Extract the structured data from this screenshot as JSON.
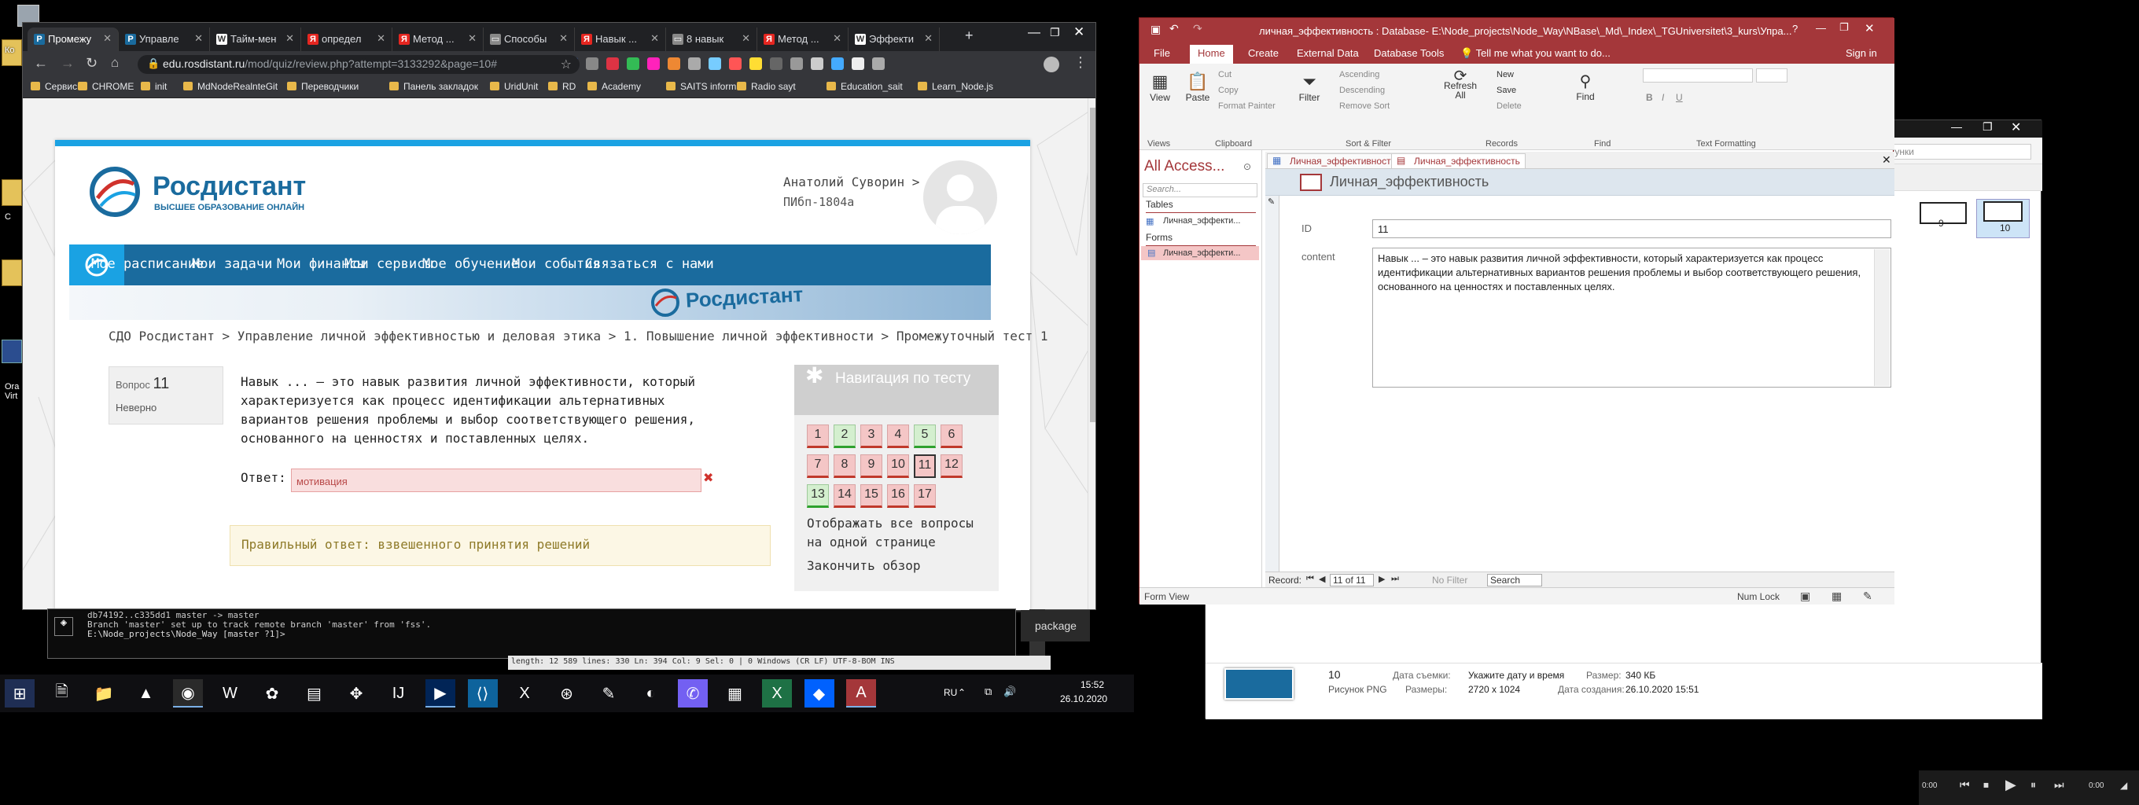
{
  "desktop": {
    "icons": [
      {
        "label": "Ко"
      },
      {
        "label": "С"
      },
      {
        "label": "Ora Virt"
      }
    ]
  },
  "chrome": {
    "tabs": [
      {
        "label": "Промежу",
        "fav": "Р",
        "color": "#1a6b9e",
        "active": true
      },
      {
        "label": "Управле",
        "fav": "Р",
        "color": "#1a6b9e"
      },
      {
        "label": "Тайм-мен",
        "fav": "W",
        "color": "#fff"
      },
      {
        "label": "определ",
        "fav": "Я",
        "color": "#e52620"
      },
      {
        "label": "Метод ...",
        "fav": "Я",
        "color": "#e52620"
      },
      {
        "label": "Способы",
        "fav": "▭",
        "color": "#888"
      },
      {
        "label": "Навык ...",
        "fav": "Я",
        "color": "#e52620"
      },
      {
        "label": "8 навык",
        "fav": "▭",
        "color": "#888"
      },
      {
        "label": "Метод ...",
        "fav": "Я",
        "color": "#e52620"
      },
      {
        "label": "Эффекти",
        "fav": "W",
        "color": "#fff"
      }
    ],
    "url_host": "edu.rosdistant.ru",
    "url_path": "/mod/quiz/review.php?attempt=3133292&page=10#",
    "bookmarks": [
      "Сервисы",
      "CHROME",
      "init",
      "MdNodeRealnteGit",
      "Переводчики",
      "Панель закладок",
      "UridUnit",
      "RD",
      "Academy",
      "SAITS inform",
      "Radio sayt",
      "Education_sait",
      "Learn_Node.js"
    ]
  },
  "site": {
    "brand": "Росдистант",
    "tagline": "ВЫСШЕЕ ОБРАЗОВАНИЕ ОНЛАЙН",
    "user_name": "Анатолий Суворин",
    "user_chev": ">",
    "user_group": "ПИбп-1804а",
    "nav": [
      "Мое расписание",
      "Мои задачи",
      "Мои финансы",
      "Мои сервисы",
      "Мое обучение",
      "Мои события",
      "Связаться с нами"
    ],
    "banner_brand": "Росдистант",
    "breadcrumb": "СДО Росдистант > Управление личной эффективностью и деловая этика > 1. Повышение личной эффективности > Промежуточный тест 1"
  },
  "quiz": {
    "qlabel": "Вопрос",
    "qnum": "11",
    "status": "Неверно",
    "text": "Навык ... – это навык развития личной эффективности, который характеризуется как процесс идентификации альтернативных вариантов решения проблемы и выбор соответствующего решения, основанного на ценностях и поставленных целях.",
    "answer_label": "Ответ:",
    "answer_value": "мотивация",
    "wrong_mark": "✖",
    "correct": "Правильный ответ: взвешенного принятия решений",
    "nav_title": "Навигация по тесту",
    "questions": [
      {
        "n": "1",
        "s": "bad"
      },
      {
        "n": "2",
        "s": "ok"
      },
      {
        "n": "3",
        "s": "bad"
      },
      {
        "n": "4",
        "s": "bad"
      },
      {
        "n": "5",
        "s": "ok"
      },
      {
        "n": "6",
        "s": "bad"
      },
      {
        "n": "7",
        "s": "bad"
      },
      {
        "n": "8",
        "s": "bad"
      },
      {
        "n": "9",
        "s": "bad"
      },
      {
        "n": "10",
        "s": "bad"
      },
      {
        "n": "11",
        "s": "cur"
      },
      {
        "n": "12",
        "s": "bad"
      },
      {
        "n": "13",
        "s": "ok"
      },
      {
        "n": "14",
        "s": "bad"
      },
      {
        "n": "15",
        "s": "bad"
      },
      {
        "n": "16",
        "s": "bad"
      },
      {
        "n": "17",
        "s": "bad"
      }
    ],
    "show_all": "Отображать все вопросы на одной странице",
    "finish": "Закончить обзор"
  },
  "terminal": {
    "lines": [
      "db74192..c335dd1  master -> master",
      "Branch 'master' set up to track remote branch 'master' from 'fss'.",
      "E:\\Node_projects\\Node_Way [master ?1]>"
    ],
    "package_label": "package",
    "editor_status": "length: 12 589    lines: 330        Ln: 394    Col: 9   Sel: 0 | 0              Windows (CR LF)     UTF-8-BOM         INS"
  },
  "access": {
    "title": "личная_эффективность : Database- E:\\Node_projects\\Node_Way\\NBase\\_Md\\_Index\\_TGUniversitet\\3_kurs\\Упра...",
    "window_btns": [
      "?",
      "—",
      "❐",
      "✕"
    ],
    "tabs": [
      "File",
      "Home",
      "Create",
      "External Data",
      "Database Tools"
    ],
    "tell_me": "Tell me what you want to do...",
    "sign_in": "Sign in",
    "ribbon": {
      "view": "View",
      "paste": "Paste",
      "cut": "Cut",
      "copy": "Copy",
      "format_painter": "Format Painter",
      "filter": "Filter",
      "ascending": "Ascending",
      "descending": "Descending",
      "remove_sort": "Remove Sort",
      "refresh": "Refresh All",
      "new": "New",
      "save": "Save",
      "delete": "Delete",
      "find": "Find",
      "groups": [
        "Views",
        "Clipboard",
        "Sort & Filter",
        "Records",
        "Find",
        "Text Formatting"
      ]
    },
    "nav_title": "All Access...",
    "nav_search": "Search...",
    "tables_hdr": "Tables",
    "table_item": "Личная_эффекти...",
    "forms_hdr": "Forms",
    "form_item": "Личная_эффекти...",
    "doc_tabs": [
      "Личная_эффективность",
      "Личная_эффективность"
    ],
    "form_title": "Личная_эффективность",
    "id_label": "ID",
    "id_value": "11",
    "content_label": "content",
    "content_value": "Навык ... – это навык развития личной эффективности, который характеризуется как процесс идентификации альтернативных вариантов решения проблемы и выбор соответствующего решения, основанного на ценностях и поставленных целях.",
    "record_label": "Record:",
    "record_value": "11 of 11",
    "no_filter": "No Filter",
    "search": "Search",
    "status_left": "Form View",
    "status_numlock": "Num Lock"
  },
  "explorer": {
    "search_placeholder": "рисунки",
    "thumbs": [
      "9",
      "10"
    ],
    "file_name": "10",
    "file_type": "Рисунок PNG",
    "date_label": "Дата съемки:",
    "date_value": "Укажите дату и время",
    "dims_label": "Размеры:",
    "dims_value": "2720 x 1024",
    "size_label": "Размер:",
    "size_value": "340 КБ",
    "created_label": "Дата создания:",
    "created_value": "26.10.2020 15:51"
  },
  "taskbar": {
    "apps": [
      {
        "name": "start-button",
        "g": "⊞"
      },
      {
        "name": "explorer-app",
        "g": "🗎"
      },
      {
        "name": "files-app",
        "g": "📁"
      },
      {
        "name": "app-a",
        "g": "▲"
      },
      {
        "name": "chrome-app",
        "g": "◉",
        "run": true
      },
      {
        "name": "app-word",
        "g": "W"
      },
      {
        "name": "app-plugin",
        "g": "✿"
      },
      {
        "name": "app-notes",
        "g": "▤"
      },
      {
        "name": "app-net",
        "g": "✥"
      },
      {
        "name": "app-ij",
        "g": "IJ"
      },
      {
        "name": "powershell-app",
        "g": "▶",
        "run": true
      },
      {
        "name": "vscode-app",
        "g": "⟨⟩"
      },
      {
        "name": "app-x",
        "g": "X"
      },
      {
        "name": "app-bear",
        "g": "⊛"
      },
      {
        "name": "app-p",
        "g": "✎"
      },
      {
        "name": "app-fox",
        "g": "◐"
      },
      {
        "name": "viber-app",
        "g": "✆"
      },
      {
        "name": "app-calc",
        "g": "▦"
      },
      {
        "name": "excel-app",
        "g": "X"
      },
      {
        "name": "dropbox-app",
        "g": "◆"
      },
      {
        "name": "access-app",
        "g": "A",
        "run": true
      }
    ],
    "lang": "RU",
    "time": "15:52",
    "date": "26.10.2020"
  },
  "media": {
    "time_left": "0:00",
    "time_right": "0:00"
  }
}
